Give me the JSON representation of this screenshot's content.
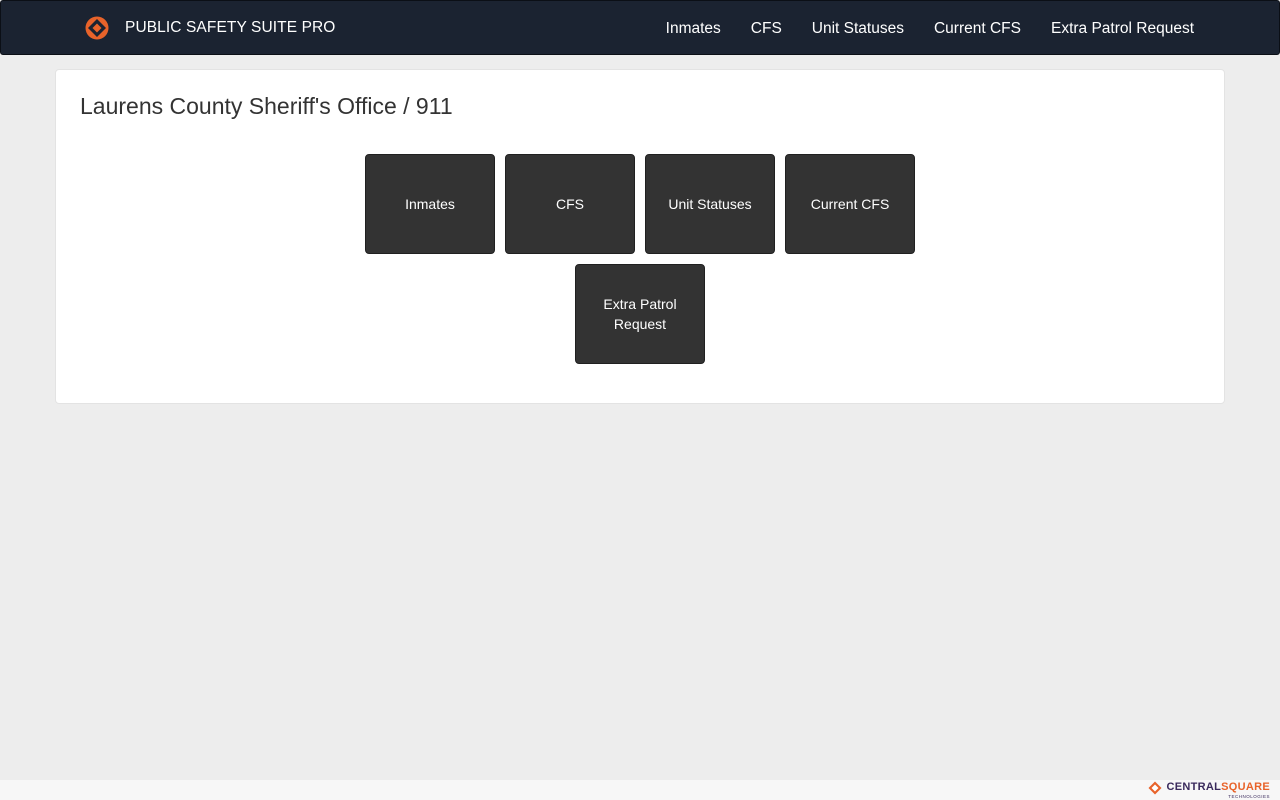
{
  "navbar": {
    "brand": "PUBLIC SAFETY SUITE PRO",
    "logo_icon": "diamond-logo-icon",
    "links": [
      "Inmates",
      "CFS",
      "Unit Statuses",
      "Current CFS",
      "Extra Patrol Request"
    ]
  },
  "panel": {
    "title": "Laurens County Sheriff's Office / 911",
    "tiles": [
      "Inmates",
      "CFS",
      "Unit Statuses",
      "Current CFS",
      "Extra Patrol Request"
    ]
  },
  "footer": {
    "logo_part1": "CENTRAL",
    "logo_part2": "SQUARE",
    "logo_sub": "TECHNOLOGIES"
  },
  "colors": {
    "navbar": "#1b2331",
    "tile": "#333333",
    "accent": "#e8632a",
    "background": "#ededed"
  }
}
